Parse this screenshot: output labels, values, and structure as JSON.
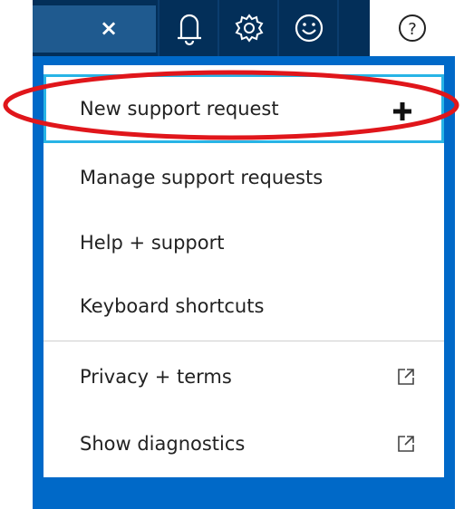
{
  "topbar": {
    "close_symbol": "×",
    "bell_icon": "bell-icon",
    "gear_icon": "gear-icon",
    "smile_icon": "smiley-icon",
    "help_icon": "help-icon",
    "help_symbol": "?"
  },
  "menu": {
    "items": [
      {
        "label": "New support request",
        "trail_icon": "plus-icon"
      },
      {
        "label": "Manage support requests"
      },
      {
        "label": "Help + support"
      },
      {
        "label": "Keyboard shortcuts"
      },
      {
        "label": "Privacy + terms",
        "trail_icon": "external-link-icon"
      },
      {
        "label": "Show diagnostics",
        "trail_icon": "external-link-icon"
      }
    ]
  },
  "colors": {
    "topbar": "#032f59",
    "panel": "#0069c8",
    "focus_border": "#28b4e6",
    "annotation": "#e0161b"
  }
}
